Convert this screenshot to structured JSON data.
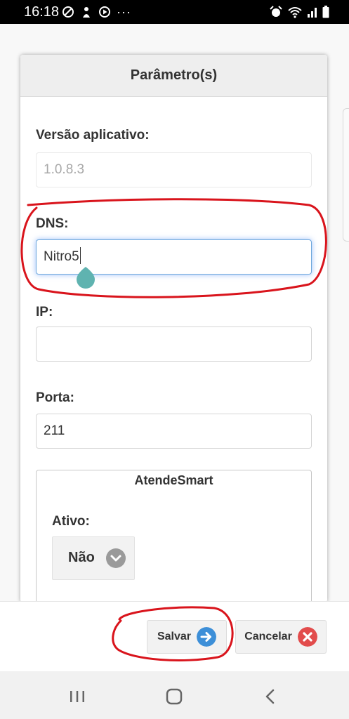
{
  "status_bar": {
    "time": "16:18",
    "left_icons": [
      "do-not-disturb-icon",
      "baby-mode-icon",
      "media-play-icon"
    ],
    "overflow_dots": "···",
    "right_icons": [
      "alarm-icon",
      "wifi-icon",
      "signal-icon",
      "battery-icon"
    ]
  },
  "dialog": {
    "title": "Parâmetro(s)",
    "fields": {
      "versao": {
        "label": "Versão aplicativo:",
        "value": "1.0.8.3"
      },
      "dns": {
        "label": "DNS:",
        "value": "Nitro5"
      },
      "ip": {
        "label": "IP:",
        "value": ""
      },
      "porta": {
        "label": "Porta:",
        "value": "211"
      }
    },
    "atendesmart": {
      "legend": "AtendeSmart",
      "ativo_label": "Ativo:",
      "ativo_value": "Não"
    }
  },
  "footer": {
    "save_label": "Salvar",
    "cancel_label": "Cancelar"
  },
  "navbar": {
    "icons": [
      "recent-apps-icon",
      "home-icon",
      "back-icon"
    ]
  },
  "colors": {
    "annotation": "#d9141c",
    "save_icon": "#3d8fd8",
    "cancel_icon": "#e24c4c",
    "cursor_handle": "#5fb3b0",
    "focus_glow": "#4285f4"
  }
}
